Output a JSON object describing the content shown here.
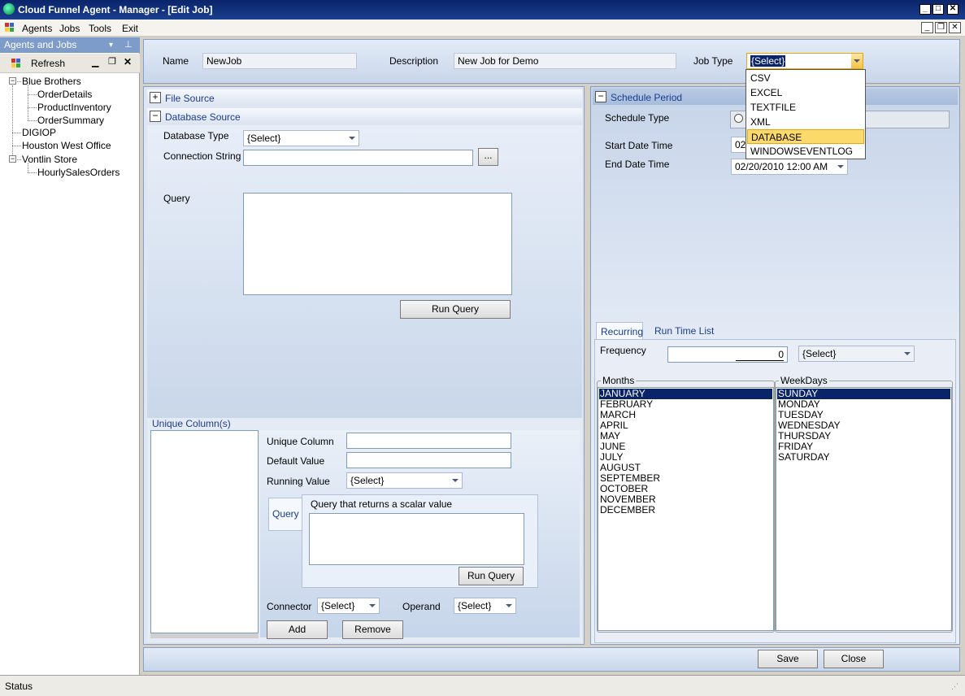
{
  "window": {
    "title": "Cloud Funnel Agent - Manager - [Edit Job]",
    "minimize": "_",
    "maximize": "□",
    "close": "✕"
  },
  "menu": {
    "items": [
      "Agents",
      "Jobs",
      "Tools",
      "Exit"
    ],
    "mdi_min": "_",
    "mdi_restore": "❐",
    "mdi_close": "✕"
  },
  "sidebar": {
    "title": "Agents and Jobs",
    "refresh_label": "Refresh",
    "tree": [
      {
        "label": "Blue Brothers",
        "expander": "−"
      },
      {
        "label": "OrderDetails"
      },
      {
        "label": "ProductInventory"
      },
      {
        "label": "OrderSummary"
      },
      {
        "label": "DIGIOP"
      },
      {
        "label": "Houston West Office"
      },
      {
        "label": "Vontlin Store",
        "expander": "−"
      },
      {
        "label": "HourlySalesOrders"
      }
    ]
  },
  "job": {
    "name_label": "Name",
    "name_value": "NewJob",
    "description_label": "Description",
    "description_value": "New Job for Demo",
    "job_type_label": "Job Type",
    "job_type_value": "{Select}",
    "job_type_options": [
      "CSV",
      "EXCEL",
      "TEXTFILE",
      "XML",
      "DATABASE",
      "WINDOWSEVENTLOG"
    ],
    "job_type_highlighted": "DATABASE"
  },
  "source": {
    "file_source_label": "File Source",
    "file_source_expander": "+",
    "database_source_label": "Database Source",
    "database_source_expander": "−",
    "database_type_label": "Database Type",
    "database_type_value": "{Select}",
    "connection_string_label": "Connection String",
    "connection_string_value": "",
    "browse_label": "...",
    "query_label": "Query",
    "query_value": "",
    "run_query_label": "Run Query"
  },
  "unique": {
    "section_label": "Unique Column(s)",
    "unique_column_label": "Unique Column",
    "default_value_label": "Default Value",
    "running_value_label": "Running Value",
    "running_value_value": "{Select}",
    "query_tab_label": "Query",
    "query_caption": "Query that returns a scalar value",
    "run_query_label": "Run Query",
    "connector_label": "Connector",
    "connector_value": "{Select}",
    "operand_label": "Operand",
    "operand_value": "{Select}",
    "add_label": "Add",
    "remove_label": "Remove"
  },
  "schedule": {
    "section_label": "Schedule Period",
    "expander": "−",
    "schedule_type_label": "Schedule Type",
    "start_label": "Start Date Time",
    "start_value": "02",
    "end_label": "End Date Time",
    "end_value": "02/20/2010 12:00 AM",
    "tabs": [
      "Recurring",
      "Run Time List"
    ],
    "frequency_label": "Frequency",
    "frequency_value": "0",
    "frequency_unit": "{Select}",
    "months_label": "Months",
    "months": [
      "JANUARY",
      "FEBRUARY",
      "MARCH",
      "APRIL",
      "MAY",
      "JUNE",
      "JULY",
      "AUGUST",
      "SEPTEMBER",
      "OCTOBER",
      "NOVEMBER",
      "DECEMBER"
    ],
    "weekdays_label": "WeekDays",
    "weekdays": [
      "SUNDAY",
      "MONDAY",
      "TUESDAY",
      "WEDNESDAY",
      "THURSDAY",
      "FRIDAY",
      "SATURDAY"
    ]
  },
  "footer": {
    "save_label": "Save",
    "close_label": "Close"
  },
  "status": {
    "text": "Status"
  }
}
